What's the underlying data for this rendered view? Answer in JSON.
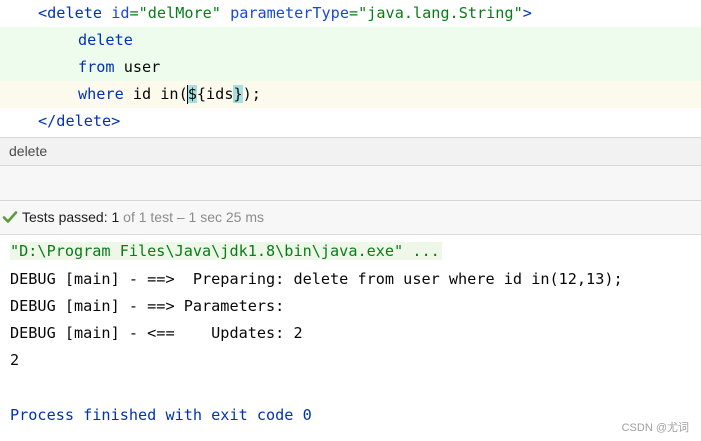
{
  "editor": {
    "line1": {
      "open": "<",
      "tag": "delete",
      "sp1": " ",
      "attr1": "id",
      "eq1": "=",
      "val1": "\"delMore\"",
      "sp2": " ",
      "attr2": "parameterType",
      "eq2": "=",
      "val2": "\"java.lang.String\"",
      "close": ">"
    },
    "line2": "delete",
    "line3_kw": "from",
    "line3_rest": " user",
    "line4": {
      "kw": "where",
      "pre": " id in(",
      "hl1": "$",
      "mid": "{ids",
      "hl2": "}",
      "post": ");"
    },
    "line5": {
      "open": "</",
      "tag": "delete",
      "close": ">"
    }
  },
  "breadcrumb": {
    "label": "delete"
  },
  "tests": {
    "status": "Tests passed: 1",
    "detail": " of 1 test – 1 sec 25 ms"
  },
  "console": {
    "command": "\"D:\\Program Files\\Java\\jdk1.8\\bin\\java.exe\" ...",
    "lines": [
      "DEBUG [main] - ==>  Preparing: delete from user where id in(12,13);",
      "DEBUG [main] - ==> Parameters: ",
      "DEBUG [main] - <==    Updates: 2",
      "2"
    ],
    "finished": "Process finished with exit code 0"
  },
  "watermark": "CSDN @尤词",
  "colors": {
    "tag": "#0033b3",
    "string": "#067d17",
    "diff_added_bg": "#edfcec",
    "highlight": "#a7e0e0",
    "success_check": "#5b9b3a"
  }
}
